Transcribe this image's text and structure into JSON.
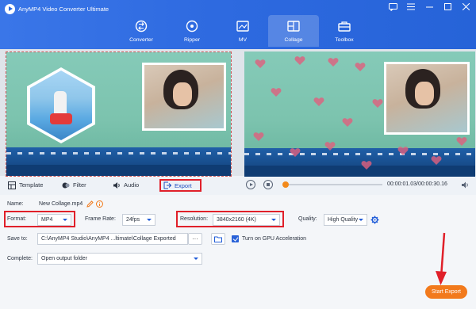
{
  "app": {
    "title": "AnyMP4 Video Converter Ultimate"
  },
  "window_controls": [
    "chat-icon",
    "menu-icon",
    "minimize-icon",
    "maximize-icon",
    "close-icon"
  ],
  "nav": [
    {
      "label": "Converter",
      "icon": "converter-icon",
      "active": false
    },
    {
      "label": "Ripper",
      "icon": "ripper-icon",
      "active": false
    },
    {
      "label": "MV",
      "icon": "mv-icon",
      "active": false
    },
    {
      "label": "Collage",
      "icon": "collage-icon",
      "active": true
    },
    {
      "label": "Toolbox",
      "icon": "toolbox-icon",
      "active": false
    }
  ],
  "tabs": {
    "template": "Template",
    "filter": "Filter",
    "audio": "Audio",
    "export": "Export"
  },
  "player": {
    "current_time": "00:00:01.03",
    "total_time": "00:00:30.16",
    "progress": 0.02
  },
  "settings": {
    "name_label": "Name:",
    "name_value": "New Collage.mp4",
    "format_label": "Format:",
    "format_value": "MP4",
    "frame_rate_label": "Frame Rate:",
    "frame_rate_value": "24fps",
    "resolution_label": "Resolution:",
    "resolution_value": "3840x2160 (4K)",
    "quality_label": "Quality:",
    "quality_value": "High Quality",
    "save_to_label": "Save to:",
    "save_to_value": "C:\\AnyMP4 Studio\\AnyMP4 ...ltimate\\Collage Exported",
    "browse_label": "···",
    "gpu_label": "Turn on GPU Acceleration",
    "gpu_checked": true,
    "complete_label": "Complete:",
    "complete_value": "Open output folder"
  },
  "start_export": "Start Export",
  "colors": {
    "accent": "#2e6ae0",
    "highlight": "#e0202a",
    "export_button": "#f27a1c"
  }
}
